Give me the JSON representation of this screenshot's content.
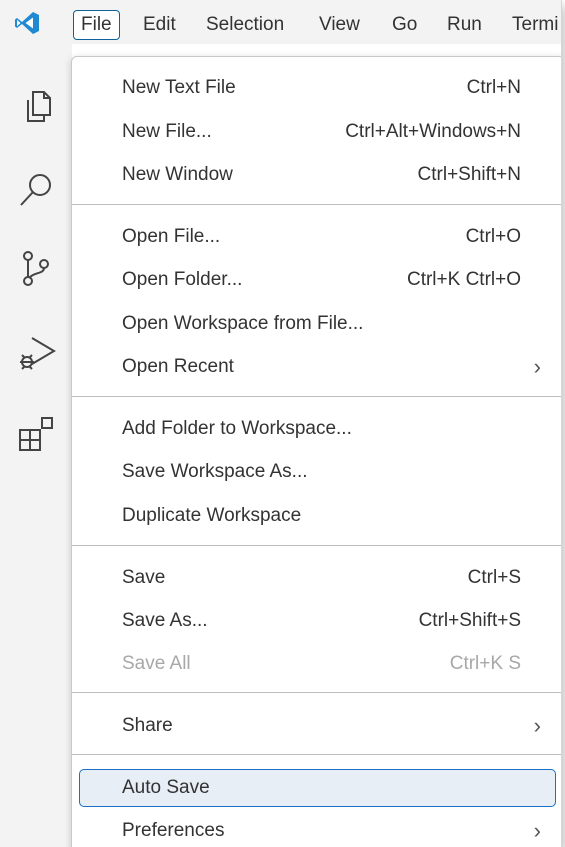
{
  "menubar": {
    "items": [
      {
        "label": "File",
        "active": true
      },
      {
        "label": "Edit"
      },
      {
        "label": "Selection"
      },
      {
        "label": "View"
      },
      {
        "label": "Go"
      },
      {
        "label": "Run"
      },
      {
        "label": "Termi"
      }
    ]
  },
  "activitybar": {
    "icons": [
      "explorer-icon",
      "search-icon",
      "source-control-icon",
      "run-debug-icon",
      "extensions-icon"
    ]
  },
  "file_menu": {
    "groups": [
      [
        {
          "label": "New Text File",
          "shortcut": "Ctrl+N"
        },
        {
          "label": "New File...",
          "shortcut": "Ctrl+Alt+Windows+N"
        },
        {
          "label": "New Window",
          "shortcut": "Ctrl+Shift+N"
        }
      ],
      [
        {
          "label": "Open File...",
          "shortcut": "Ctrl+O"
        },
        {
          "label": "Open Folder...",
          "shortcut": "Ctrl+K Ctrl+O"
        },
        {
          "label": "Open Workspace from File..."
        },
        {
          "label": "Open Recent",
          "submenu": true
        }
      ],
      [
        {
          "label": "Add Folder to Workspace..."
        },
        {
          "label": "Save Workspace As..."
        },
        {
          "label": "Duplicate Workspace"
        }
      ],
      [
        {
          "label": "Save",
          "shortcut": "Ctrl+S"
        },
        {
          "label": "Save As...",
          "shortcut": "Ctrl+Shift+S"
        },
        {
          "label": "Save All",
          "shortcut": "Ctrl+K S",
          "disabled": true
        }
      ],
      [
        {
          "label": "Share",
          "submenu": true
        }
      ],
      [
        {
          "label": "Auto Save",
          "highlighted": true
        },
        {
          "label": "Preferences",
          "submenu": true
        }
      ]
    ]
  },
  "colors": {
    "accent": "#1a6fc4",
    "highlight_bg": "#e8eef6",
    "disabled_text": "#a8a8a8",
    "logo": "#1f8ad2"
  }
}
